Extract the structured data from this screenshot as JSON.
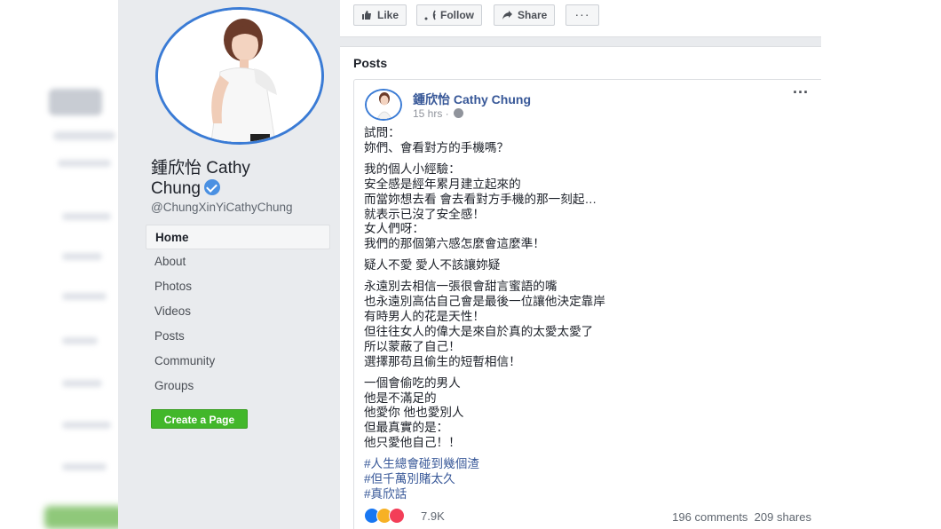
{
  "profile": {
    "name": "鍾欣怡 Cathy Chung",
    "name_line1": "鍾欣怡 Cathy",
    "name_line2": "Chung",
    "handle": "@ChungXinYiCathyChung"
  },
  "nav": {
    "items": [
      {
        "label": "Home",
        "active": true
      },
      {
        "label": "About"
      },
      {
        "label": "Photos"
      },
      {
        "label": "Videos"
      },
      {
        "label": "Posts"
      },
      {
        "label": "Community"
      },
      {
        "label": "Groups"
      }
    ],
    "create_page": "Create a Page"
  },
  "actions": {
    "like": "Like",
    "follow": "Follow",
    "share": "Share",
    "more": "···"
  },
  "posts": {
    "heading": "Posts",
    "post": {
      "author": "鍾欣怡 Cathy Chung",
      "time": "15 hrs · ",
      "menu": "···",
      "paragraphs": [
        [
          "試問：",
          "妳們、會看對方的手機嗎？"
        ],
        [
          "我的個人小經驗：",
          "安全感是經年累月建立起來的",
          "而當妳想去看 會去看對方手機的那一刻起…",
          "就表示已沒了安全感！",
          "女人們呀：",
          "我們的那個第六感怎麼會這麼準！"
        ],
        [
          "疑人不愛 愛人不該讓妳疑"
        ],
        [
          "永遠別去相信一張很會甜言蜜語的嘴",
          "也永遠別高估自己會是最後一位讓他決定靠岸",
          "有時男人的花是天性！",
          "但往往女人的偉大是來自於真的太愛太愛了",
          "所以蒙蔽了自己！",
          "選擇那苟且偷生的短暫相信！"
        ],
        [
          "一個會偷吃的男人",
          "他是不滿足的",
          "他愛你 他也愛別人",
          "但最真實的是：",
          "他只愛他自己！！"
        ]
      ],
      "hashtags": [
        "#人生總會碰到幾個渣",
        "#但千萬別賭太久",
        "#真欣話"
      ],
      "reaction_count": "7.9K",
      "comments": "196 comments",
      "shares": "209 shares"
    }
  },
  "colors": {
    "accent": "#385898",
    "ring": "#3a7bd5",
    "green": "#42b72a",
    "like": "#1877f2",
    "haha": "#f7b125",
    "love": "#f33e58"
  },
  "icons": [
    "like-icon",
    "follow-icon",
    "share-icon",
    "globe-icon",
    "verified-icon"
  ]
}
